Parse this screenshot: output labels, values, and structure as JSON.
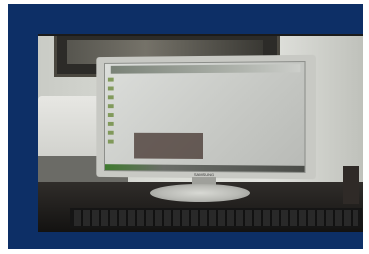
{
  "image": {
    "description": "",
    "frame_color": "#0d2f66",
    "monitor_brand": "SAMSUNG"
  }
}
